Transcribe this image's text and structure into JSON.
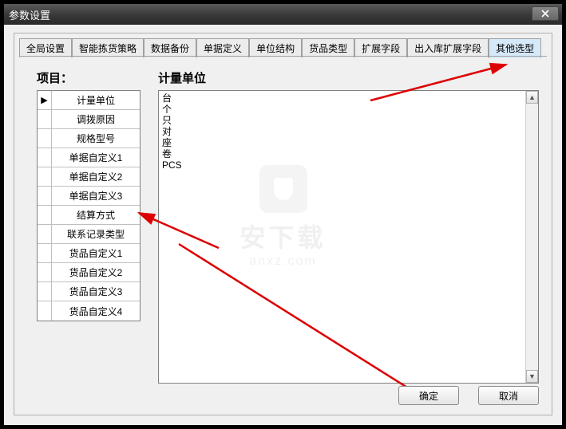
{
  "window": {
    "title": "参数设置"
  },
  "tabs": [
    {
      "label": "全局设置",
      "active": false
    },
    {
      "label": "智能拣货策略",
      "active": false
    },
    {
      "label": "数据备份",
      "active": false
    },
    {
      "label": "单据定义",
      "active": false
    },
    {
      "label": "单位结构",
      "active": false
    },
    {
      "label": "货品类型",
      "active": false
    },
    {
      "label": "扩展字段",
      "active": false
    },
    {
      "label": "出入库扩展字段",
      "active": false
    },
    {
      "label": "其他选型",
      "active": true
    }
  ],
  "labels": {
    "project": "项目：",
    "unit": "计量单位"
  },
  "project_items": [
    {
      "label": "计量单位",
      "selected": true
    },
    {
      "label": "调拨原因",
      "selected": false
    },
    {
      "label": "规格型号",
      "selected": false
    },
    {
      "label": "单据自定义1",
      "selected": false
    },
    {
      "label": "单据自定义2",
      "selected": false
    },
    {
      "label": "单据自定义3",
      "selected": false
    },
    {
      "label": "结算方式",
      "selected": false
    },
    {
      "label": "联系记录类型",
      "selected": false
    },
    {
      "label": "货品自定义1",
      "selected": false
    },
    {
      "label": "货品自定义2",
      "selected": false
    },
    {
      "label": "货品自定义3",
      "selected": false
    },
    {
      "label": "货品自定义4",
      "selected": false
    }
  ],
  "unit_values": [
    "台",
    "个",
    "只",
    "对",
    "座",
    "卷",
    "PCS"
  ],
  "buttons": {
    "ok": "确定",
    "cancel": "取消"
  },
  "watermark": {
    "text": "安下载",
    "sub": "anxz.com"
  }
}
